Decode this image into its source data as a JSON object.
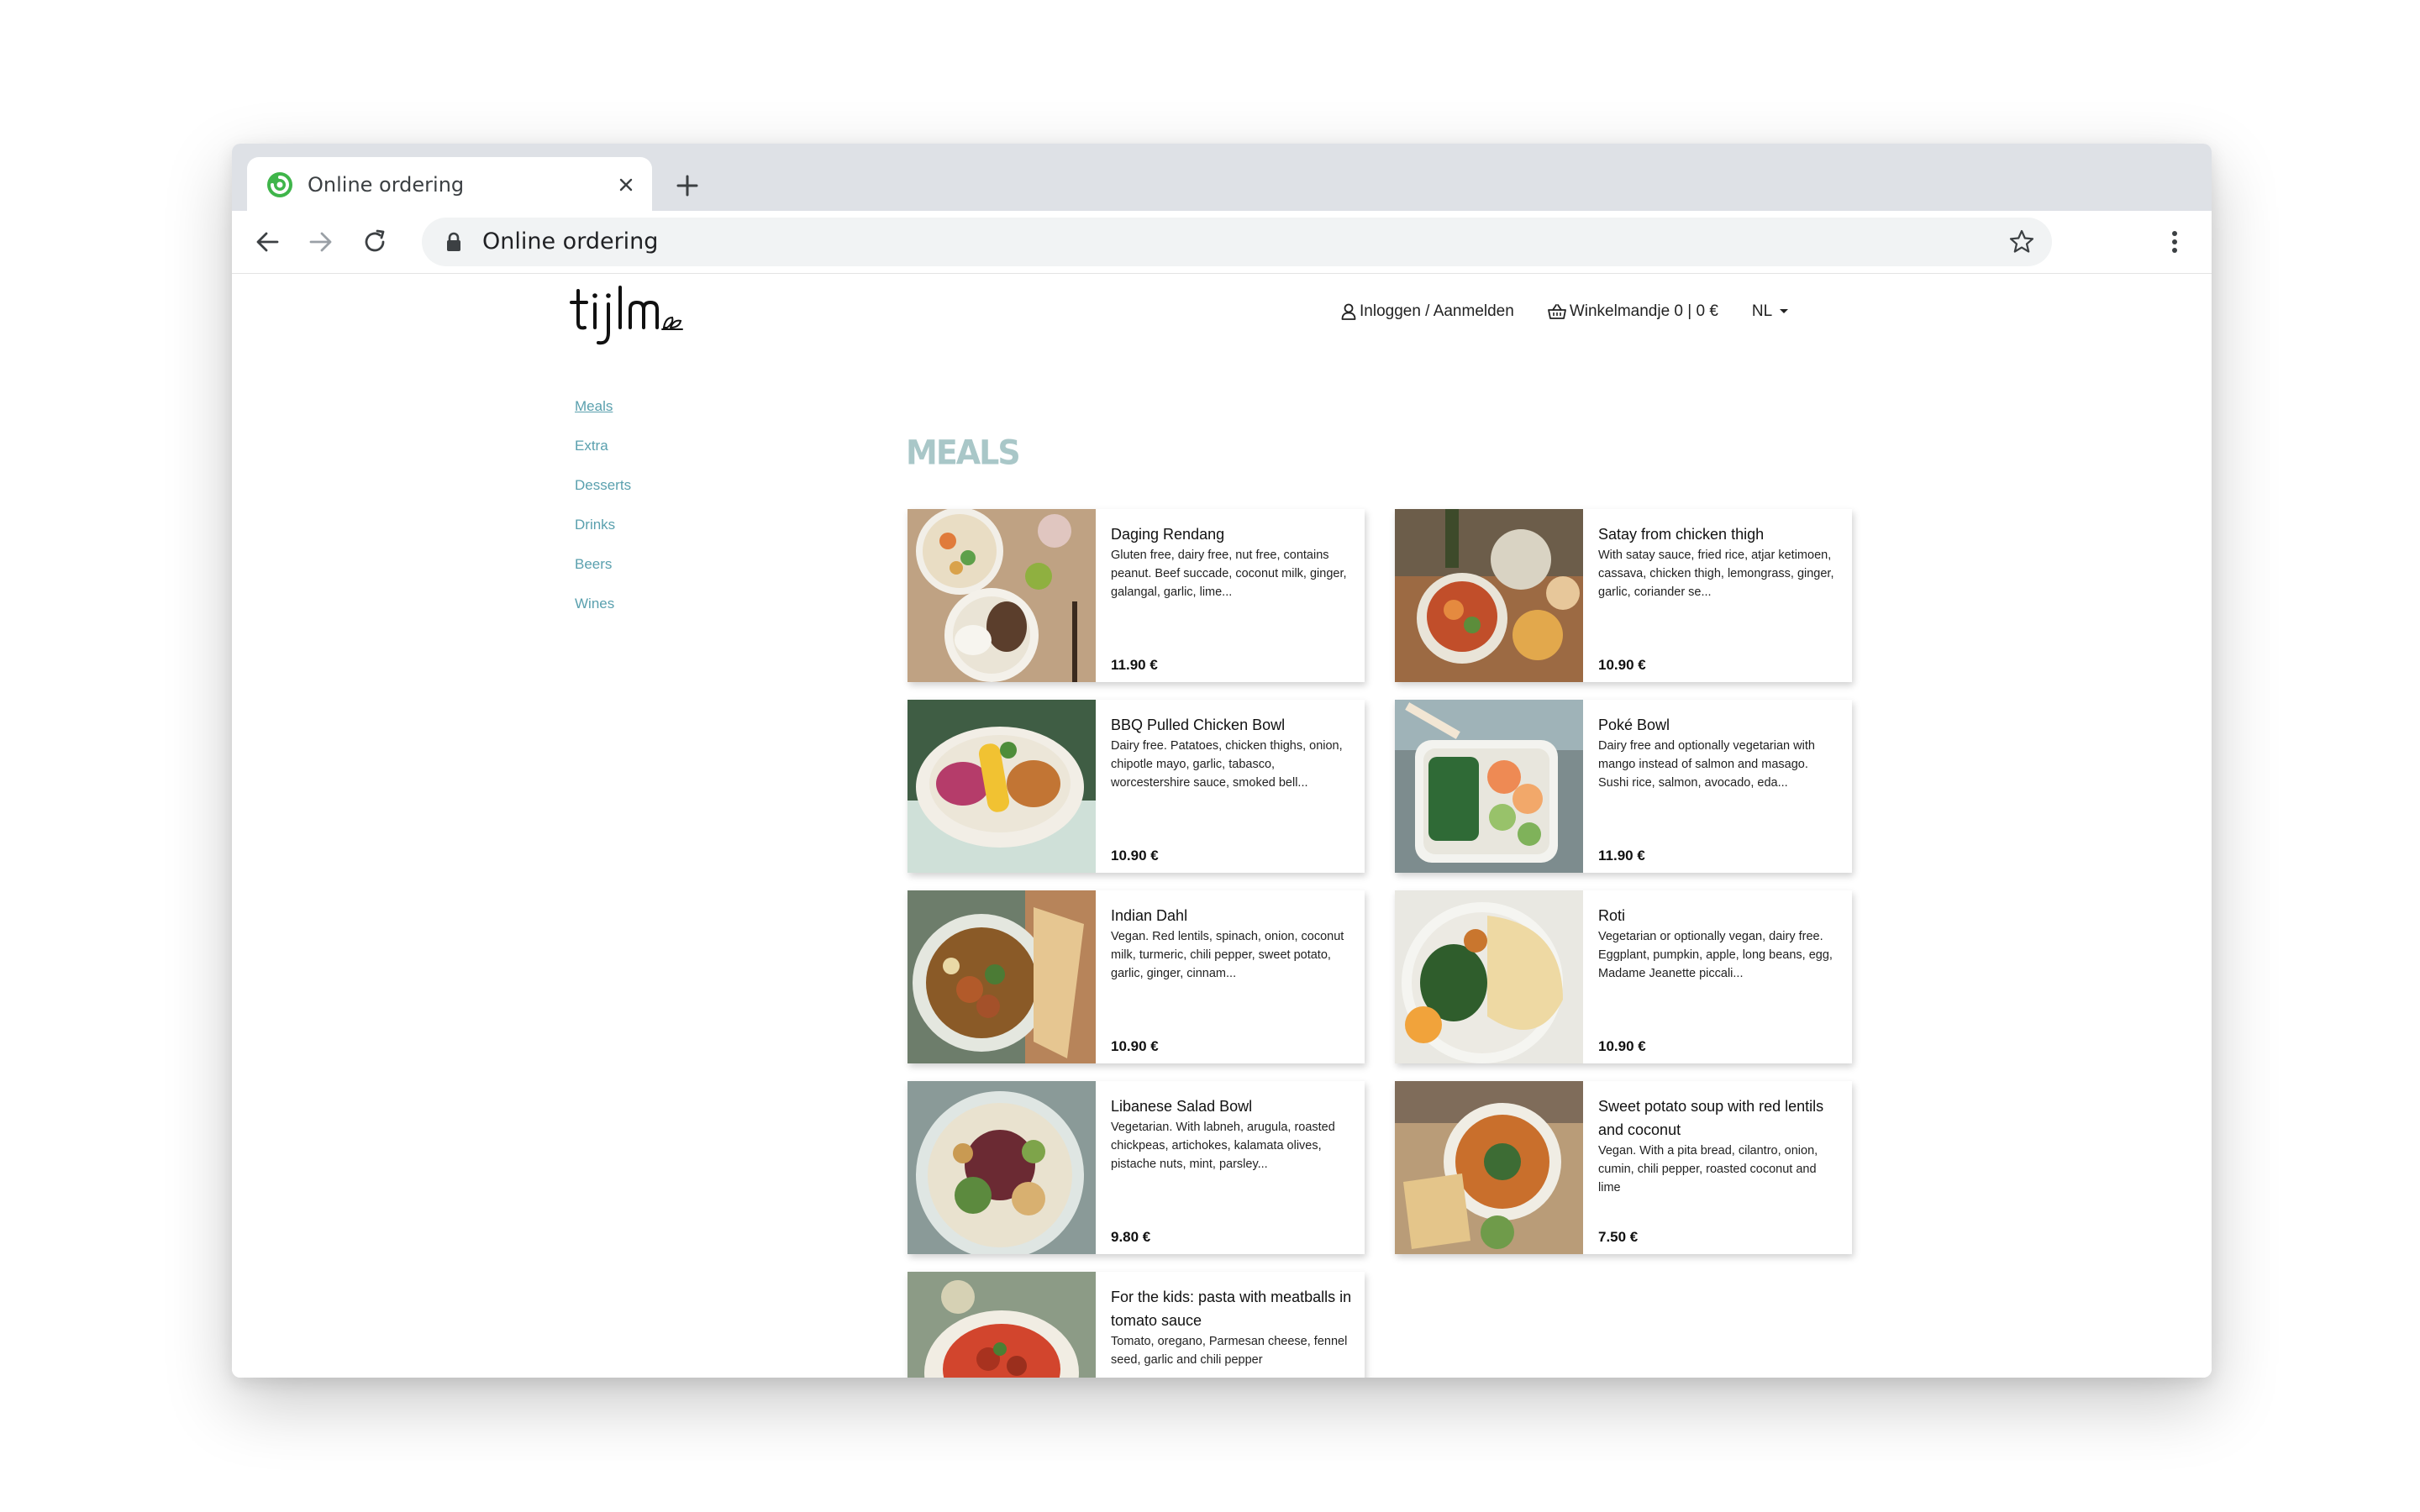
{
  "browser": {
    "tab_title": "Online ordering",
    "url": "Online ordering"
  },
  "site": {
    "nav": {
      "login": "Inloggen / Aanmelden",
      "cart": "Winkelmandje 0 | 0 €",
      "language": "NL"
    },
    "sidebar": [
      {
        "label": "Meals",
        "active": true
      },
      {
        "label": "Extra"
      },
      {
        "label": "Desserts"
      },
      {
        "label": "Drinks"
      },
      {
        "label": "Beers"
      },
      {
        "label": "Wines"
      }
    ],
    "section_title": "MEALS",
    "meals": [
      {
        "name": "Daging Rendang",
        "desc": "Gluten free, dairy free, nut free, contains peanut. Beef succade, coconut milk, ginger, galangal, garlic, lime...",
        "price": "11.90 €"
      },
      {
        "name": "Satay from chicken thigh",
        "desc": "With satay sauce, fried rice, atjar ketimoen, cassava, chicken thigh, lemongrass, ginger, garlic, coriander se...",
        "price": "10.90 €"
      },
      {
        "name": "BBQ Pulled Chicken Bowl",
        "desc": "Dairy free. Patatoes, chicken thighs, onion, chipotle mayo, garlic, tabasco, worcestershire sauce, smoked bell...",
        "price": "10.90 €"
      },
      {
        "name": "Poké Bowl",
        "desc": "Dairy free and optionally vegetarian with mango instead of salmon and masago. Sushi rice, salmon, avocado, eda...",
        "price": "11.90 €"
      },
      {
        "name": "Indian Dahl",
        "desc": "Vegan. Red lentils, spinach, onion, coconut milk, turmeric, chili pepper, sweet potato, garlic, ginger, cinnam...",
        "price": "10.90 €"
      },
      {
        "name": "Roti",
        "desc": "Vegetarian or optionally vegan, dairy free. Eggplant, pumpkin, apple, long beans, egg, Madame Jeanette piccali...",
        "price": "10.90 €"
      },
      {
        "name": "Libanese Salad Bowl",
        "desc": "Vegetarian. With labneh, arugula, roasted chickpeas, artichokes, kalamata olives, pistache nuts, mint, parsley...",
        "price": "9.80 €"
      },
      {
        "name": "Sweet potato soup with red lentils and coconut",
        "desc": "Vegan. With a pita bread, cilantro, onion, cumin, chili pepper, roasted coconut and lime",
        "price": "7.50 €"
      },
      {
        "name": "For the kids: pasta with meatballs in tomato sauce",
        "desc": "Tomato, oregano, Parmesan cheese, fennel seed, garlic and chili pepper",
        "price": ""
      }
    ]
  }
}
